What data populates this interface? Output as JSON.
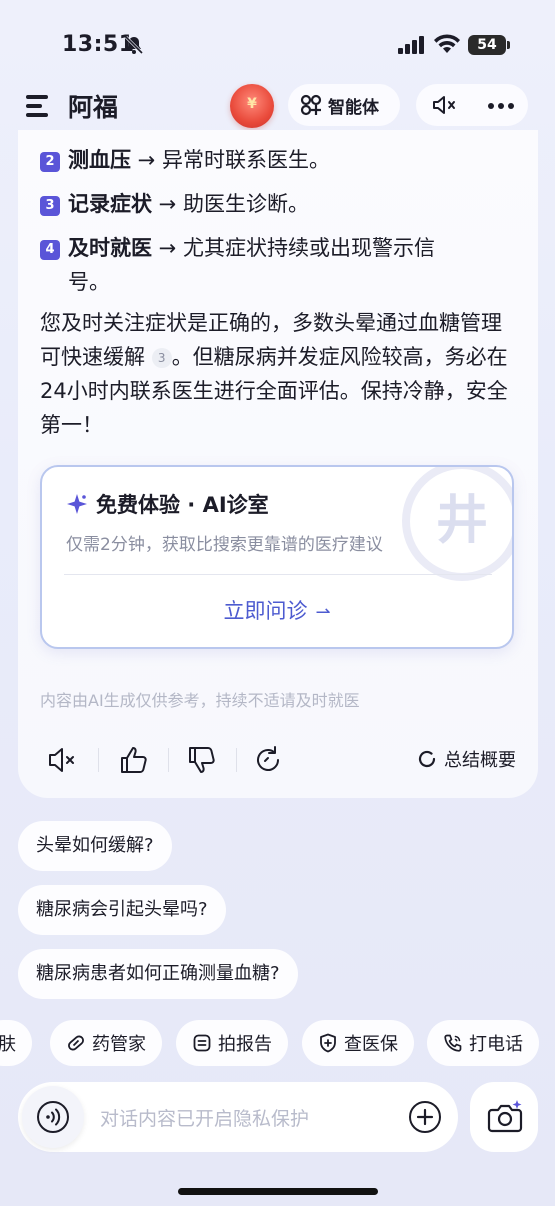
{
  "status": {
    "time": "13:51",
    "battery": "54"
  },
  "header": {
    "title": "阿福",
    "agent_label": "智能体"
  },
  "message": {
    "items": [
      {
        "num": "2",
        "bold": "测血压",
        "rest": " → 异常时联系医生。"
      },
      {
        "num": "3",
        "bold": "记录症状",
        "rest": " → 助医生诊断。"
      },
      {
        "num": "4",
        "bold": "及时就医",
        "rest": " → 尤其症状持续或出现警示信",
        "cont": "号。"
      }
    ],
    "para_1": "您及时关注症状是正确的，多数头晕通过血糖管理可快速缓解",
    "cite": "3",
    "para_2": "。但糖尿病并发症风险较高，务必在24小时内联系医生进行全面评估。保持冷静，安全第一！",
    "disclaimer": "内容由AI生成仅供参考，持续不适请及时就医",
    "summary_label": "总结概要"
  },
  "promo": {
    "title": "免费体验 · AI诊室",
    "subtitle": "仅需2分钟，获取比搜索更靠谱的医疗建议",
    "cta": "立即问诊",
    "watermark": "井"
  },
  "suggestions": [
    "头晕如何缓解?",
    "糖尿病会引起头晕吗?",
    "糖尿病患者如何正确测量血糖?"
  ],
  "chips": [
    "肤",
    "药管家",
    "拍报告",
    "查医保",
    "打电话"
  ],
  "input": {
    "placeholder": "对话内容已开启隐私保护"
  },
  "colors": {
    "accent": "#5a55d8",
    "link": "#4d5bd0",
    "bg": "#eef0fb"
  }
}
